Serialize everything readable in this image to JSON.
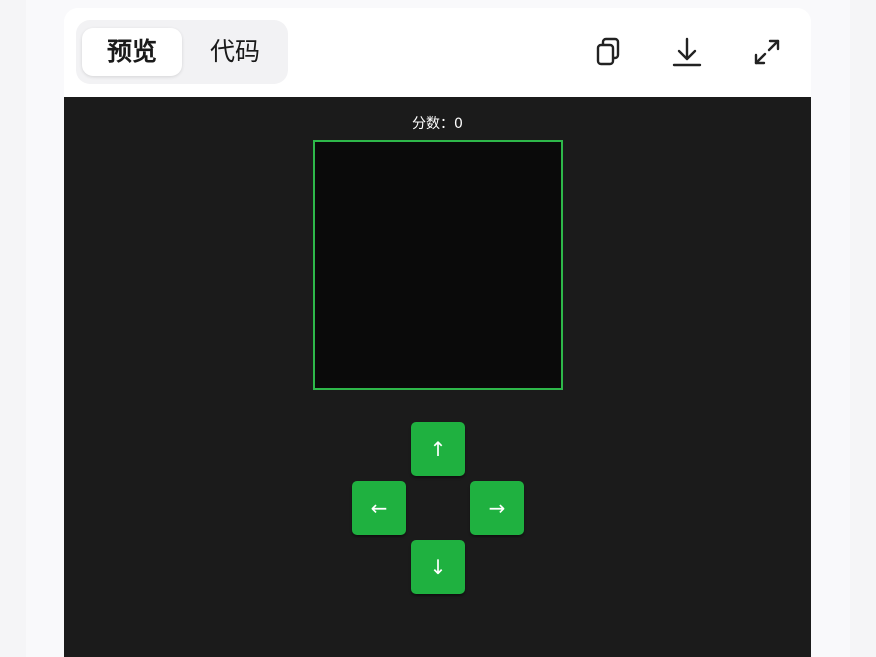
{
  "tabs": {
    "preview_label": "预览",
    "code_label": "代码"
  },
  "toolbar": {
    "icons": [
      "copy-icon",
      "download-icon",
      "expand-icon"
    ]
  },
  "game": {
    "score_text": "分数：0",
    "controls": {
      "up": "↑",
      "left": "←",
      "right": "→",
      "down": "↓"
    }
  },
  "colors": {
    "accent_green": "#1fb140",
    "board_border": "#2eb84a",
    "preview_background": "#1b1b1b",
    "board_background": "#0a0a0a"
  }
}
